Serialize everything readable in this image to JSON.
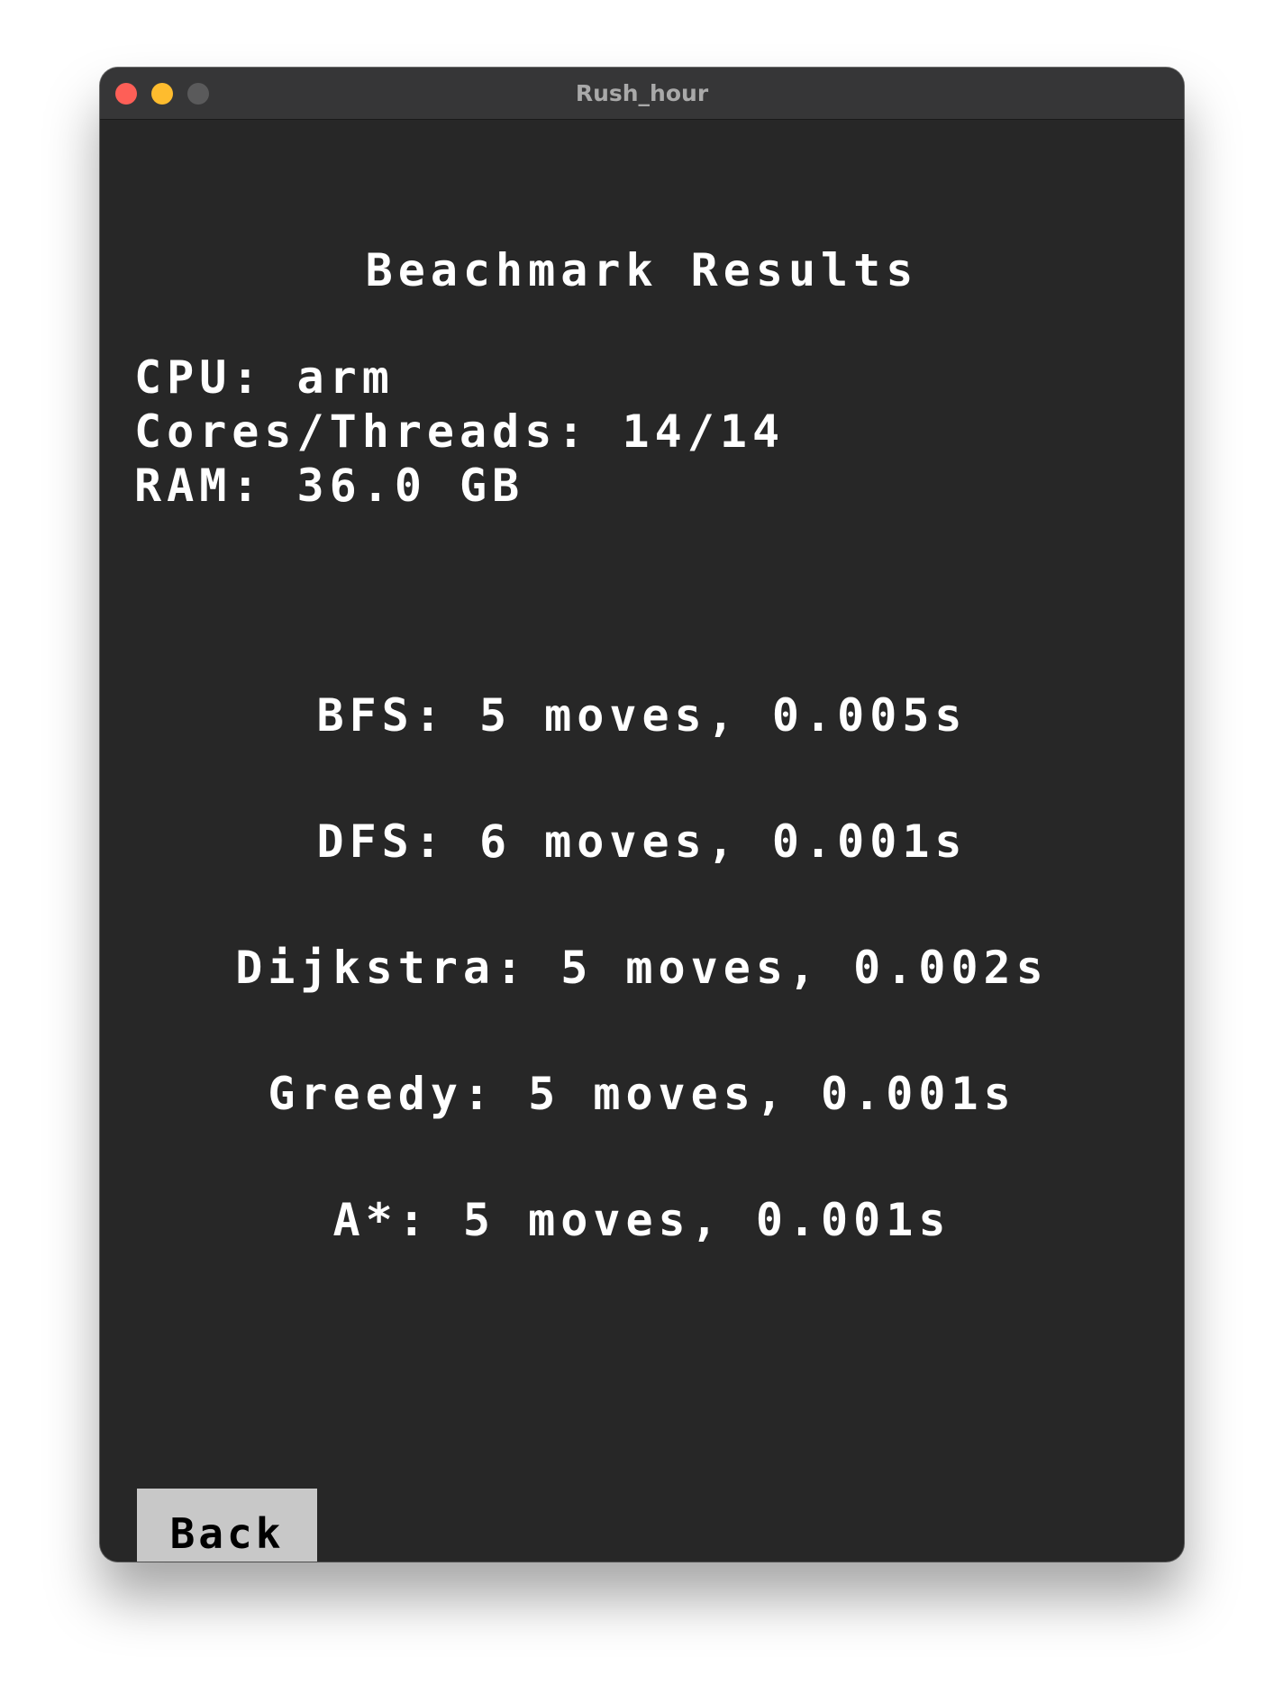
{
  "window": {
    "title": "Rush_hour"
  },
  "heading": "Beachmark Results",
  "system": {
    "cpu": "CPU: arm",
    "cores": "Cores/Threads: 14/14",
    "ram": "RAM: 36.0 GB"
  },
  "results": [
    {
      "text": "BFS: 5 moves, 0.005s"
    },
    {
      "text": "DFS: 6 moves, 0.001s"
    },
    {
      "text": "Dijkstra: 5 moves, 0.002s"
    },
    {
      "text": "Greedy: 5 moves, 0.001s"
    },
    {
      "text": "A*: 5 moves, 0.001s"
    }
  ],
  "back_button": {
    "label": "Back"
  },
  "colors": {
    "window_bg": "#272727",
    "titlebar_bg": "#363637",
    "text": "#ffffff",
    "button_bg": "#c8c8c8",
    "close": "#fe5f57",
    "minimize": "#febc2e",
    "maximize_inactive": "#5a5a5b"
  }
}
